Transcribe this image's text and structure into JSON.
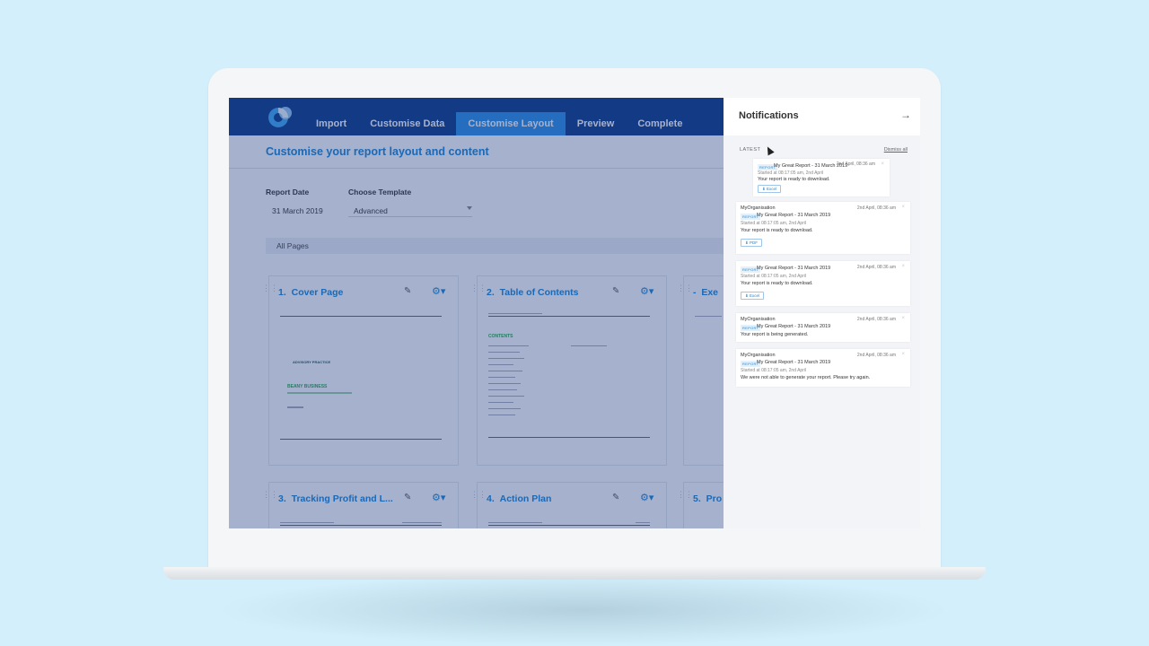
{
  "app": {
    "nav": [
      "Import",
      "Customise Data",
      "Customise Layout",
      "Preview",
      "Complete"
    ],
    "page_title": "Customise your report layout and content",
    "report_date_label": "Report Date",
    "report_date_value": "31 March 2019",
    "template_label": "Choose Template",
    "template_value": "Advanced",
    "pages_filter": "All Pages",
    "cards": [
      {
        "num": "1.",
        "title": "Cover Page"
      },
      {
        "num": "2.",
        "title": "Table of Contents"
      },
      {
        "num": "-",
        "title": "Exe"
      },
      {
        "num": "3.",
        "title": "Tracking Profit and L..."
      },
      {
        "num": "4.",
        "title": "Action Plan"
      },
      {
        "num": "5.",
        "title": "Pro"
      }
    ],
    "cover_brand": "ADVISORY PRACTICE",
    "cover_company": "BEANY BUSINESS",
    "toc_heading": "CONTENTS"
  },
  "notifications": {
    "title": "Notifications",
    "latest_label": "LATEST",
    "dismiss_all": "Dismiss all",
    "items": [
      {
        "org": "",
        "badge": "REPORT",
        "report": "My Great Report - 31 March 2019",
        "date": "2nd April, 08:36 am",
        "started": "Started at 08:17:05 am, 2nd April",
        "message": "Your report is ready to download.",
        "button": "Excel"
      },
      {
        "org": "MyOrganisation",
        "badge": "REPORT",
        "report": "My Great Report - 31 March 2019",
        "date": "2nd April, 08:36 am",
        "started": "Started at 08:17:05 am, 2nd April",
        "message": "Your report is ready to download.",
        "button": "PDF"
      },
      {
        "org": "",
        "badge": "REPORT",
        "report": "My Great Report - 31 March 2019",
        "date": "2nd April, 08:36 am",
        "started": "Started at 08:17:05 am, 2nd April",
        "message": "Your report is ready to download.",
        "button": "Excel"
      },
      {
        "org": "MyOrganisation",
        "badge": "REPORT",
        "report": "My Great Report - 31 March 2019",
        "date": "2nd April, 08:36 am",
        "started": "",
        "message": "Your report is being generated.",
        "button": ""
      },
      {
        "org": "MyOrganisation",
        "badge": "REPORT",
        "report": "My Great Report - 31 March 2019",
        "date": "2nd April, 08:36 am",
        "started": "Started at 08:17:05 am, 2nd April",
        "message": "We were not able to generate your report. Please try again.",
        "button": ""
      }
    ]
  },
  "colors": {
    "header_blue": "#0b3a88",
    "accent_blue": "#1a87d9",
    "background": "#d3effb"
  }
}
